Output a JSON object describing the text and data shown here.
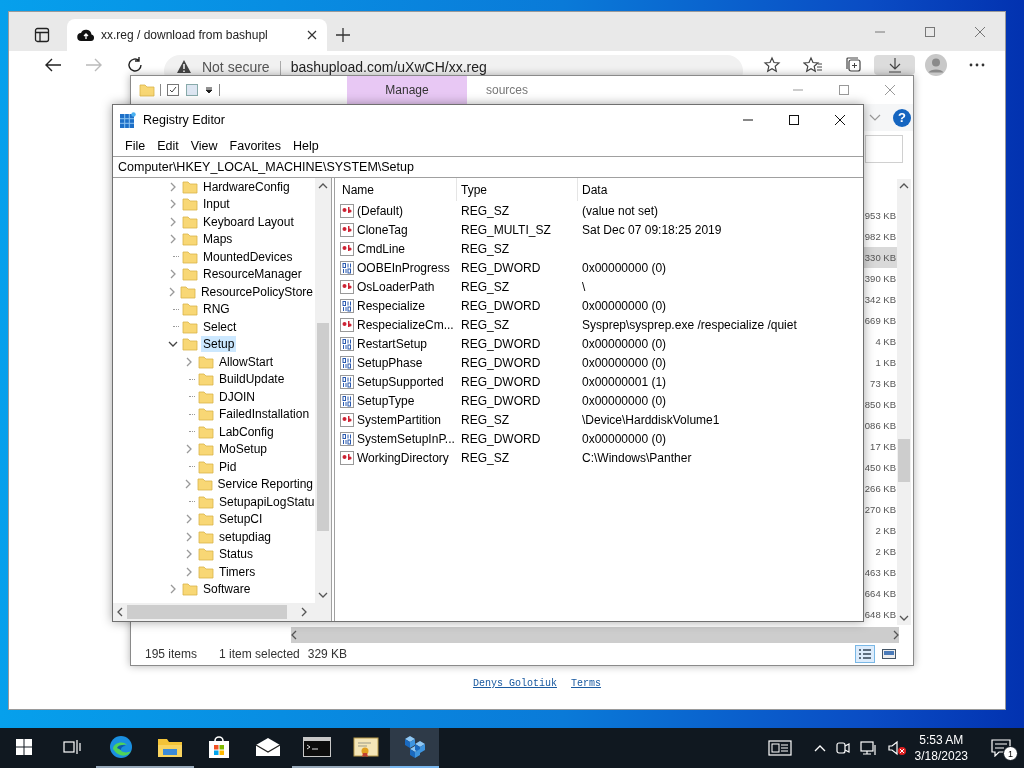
{
  "browser": {
    "tab": {
      "title": "xx.reg / download from bashupl"
    },
    "address": {
      "security": "Not secure",
      "url": "bashupload.com/uXwCH/xx.reg"
    },
    "toolbar": [
      {
        "kind": "favorite-add",
        "selected": false
      },
      {
        "kind": "favorites",
        "selected": false
      },
      {
        "kind": "collections",
        "selected": false
      },
      {
        "kind": "downloads",
        "selected": true
      },
      {
        "kind": "profile",
        "selected": false
      },
      {
        "kind": "more",
        "selected": false
      }
    ],
    "footer_links": [
      "Denys Golotiuk",
      "Terms"
    ]
  },
  "explorer": {
    "ribbon_tabs": [
      {
        "label": "Manage",
        "highlighted": true
      },
      {
        "label": "sources",
        "highlighted": false
      }
    ],
    "help_glyph": "?",
    "sizes": [
      {
        "text": "953 KB",
        "selected": false
      },
      {
        "text": "982 KB",
        "selected": false
      },
      {
        "text": "330 KB",
        "selected": true
      },
      {
        "text": "390 KB",
        "selected": false
      },
      {
        "text": "342 KB",
        "selected": false
      },
      {
        "text": "669 KB",
        "selected": false
      },
      {
        "text": "4 KB",
        "selected": false
      },
      {
        "text": "1 KB",
        "selected": false
      },
      {
        "text": "73 KB",
        "selected": false
      },
      {
        "text": "850 KB",
        "selected": false
      },
      {
        "text": "086 KB",
        "selected": false
      },
      {
        "text": "17 KB",
        "selected": false
      },
      {
        "text": "450 KB",
        "selected": false
      },
      {
        "text": "266 KB",
        "selected": false
      },
      {
        "text": "270 KB",
        "selected": false
      },
      {
        "text": "2 KB",
        "selected": false
      },
      {
        "text": "2 KB",
        "selected": false
      },
      {
        "text": "463 KB",
        "selected": false
      },
      {
        "text": "664 KB",
        "selected": false
      },
      {
        "text": "648 KB",
        "selected": false
      }
    ],
    "status": {
      "items": "195 items",
      "selection": "1 item selected",
      "size": "329 KB"
    },
    "view_buttons": [
      {
        "kind": "details",
        "selected": true
      },
      {
        "kind": "thumbnails",
        "selected": false
      }
    ]
  },
  "registry_editor": {
    "title": "Registry Editor",
    "menu": [
      "File",
      "Edit",
      "View",
      "Favorites",
      "Help"
    ],
    "address": "Computer\\HKEY_LOCAL_MACHINE\\SYSTEM\\Setup",
    "tree": [
      {
        "label": "HardwareConfig",
        "expandable": true,
        "expanded": false,
        "selected": false
      },
      {
        "label": "Input",
        "expandable": true,
        "expanded": false,
        "selected": false
      },
      {
        "label": "Keyboard Layout",
        "expandable": true,
        "expanded": false,
        "selected": false
      },
      {
        "label": "Maps",
        "expandable": true,
        "expanded": false,
        "selected": false
      },
      {
        "label": "MountedDevices",
        "expandable": false,
        "selected": false
      },
      {
        "label": "ResourceManager",
        "expandable": true,
        "expanded": false,
        "selected": false
      },
      {
        "label": "ResourcePolicyStore",
        "expandable": true,
        "expanded": false,
        "selected": false
      },
      {
        "label": "RNG",
        "expandable": false,
        "selected": false
      },
      {
        "label": "Select",
        "expandable": false,
        "selected": false
      },
      {
        "label": "Setup",
        "expandable": true,
        "expanded": true,
        "selected": true,
        "children": [
          {
            "label": "AllowStart",
            "expandable": true,
            "expanded": false,
            "selected": false
          },
          {
            "label": "BuildUpdate",
            "expandable": false,
            "selected": false
          },
          {
            "label": "DJOIN",
            "expandable": false,
            "selected": false
          },
          {
            "label": "FailedInstallation",
            "expandable": false,
            "selected": false
          },
          {
            "label": "LabConfig",
            "expandable": false,
            "selected": false
          },
          {
            "label": "MoSetup",
            "expandable": true,
            "expanded": false,
            "selected": false
          },
          {
            "label": "Pid",
            "expandable": false,
            "selected": false
          },
          {
            "label": "Service Reporting",
            "expandable": true,
            "expanded": false,
            "selected": false
          },
          {
            "label": "SetupapiLogStatu",
            "expandable": false,
            "selected": false
          },
          {
            "label": "SetupCI",
            "expandable": true,
            "expanded": false,
            "selected": false
          },
          {
            "label": "setupdiag",
            "expandable": true,
            "expanded": false,
            "selected": false
          },
          {
            "label": "Status",
            "expandable": true,
            "expanded": false,
            "selected": false
          },
          {
            "label": "Timers",
            "expandable": true,
            "expanded": false,
            "selected": false
          }
        ]
      },
      {
        "label": "Software",
        "expandable": true,
        "expanded": false,
        "selected": false
      }
    ],
    "columns": [
      "Name",
      "Type",
      "Data"
    ],
    "values": [
      {
        "kind": "string",
        "name": "(Default)",
        "type": "REG_SZ",
        "data": "(value not set)"
      },
      {
        "kind": "string",
        "name": "CloneTag",
        "type": "REG_MULTI_SZ",
        "data": "Sat Dec 07 09:18:25 2019"
      },
      {
        "kind": "string",
        "name": "CmdLine",
        "type": "REG_SZ"
      },
      {
        "kind": "binary",
        "name": "OOBEInProgress",
        "type": "REG_DWORD",
        "data": "0x00000000 (0)"
      },
      {
        "kind": "string",
        "name": "OsLoaderPath",
        "type": "REG_SZ",
        "data": "\\"
      },
      {
        "kind": "binary",
        "name": "Respecialize",
        "type": "REG_DWORD",
        "data": "0x00000000 (0)"
      },
      {
        "kind": "string",
        "name": "RespecializeCm...",
        "type": "REG_SZ",
        "data": "Sysprep\\sysprep.exe /respecialize /quiet"
      },
      {
        "kind": "binary",
        "name": "RestartSetup",
        "type": "REG_DWORD",
        "data": "0x00000000 (0)"
      },
      {
        "kind": "binary",
        "name": "SetupPhase",
        "type": "REG_DWORD",
        "data": "0x00000000 (0)"
      },
      {
        "kind": "binary",
        "name": "SetupSupported",
        "type": "REG_DWORD",
        "data": "0x00000001 (1)"
      },
      {
        "kind": "binary",
        "name": "SetupType",
        "type": "REG_DWORD",
        "data": "0x00000000 (0)"
      },
      {
        "kind": "string",
        "name": "SystemPartition",
        "type": "REG_SZ",
        "data": "\\Device\\HarddiskVolume1"
      },
      {
        "kind": "binary",
        "name": "SystemSetupInP...",
        "type": "REG_DWORD",
        "data": "0x00000000 (0)"
      },
      {
        "kind": "string",
        "name": "WorkingDirectory",
        "type": "REG_SZ",
        "data": "C:\\Windows\\Panther"
      }
    ]
  },
  "taskbar": {
    "apps": [
      {
        "kind": "browser",
        "running": true,
        "active": false
      },
      {
        "kind": "folder",
        "running": true,
        "active": false
      },
      {
        "kind": "store",
        "running": false,
        "active": false
      },
      {
        "kind": "mail",
        "running": false,
        "active": false
      },
      {
        "kind": "terminal",
        "running": true,
        "active": false
      },
      {
        "kind": "certificate",
        "running": true,
        "active": false
      },
      {
        "kind": "registry",
        "running": true,
        "active": true
      }
    ],
    "clock": {
      "time": "5:53 AM",
      "date": "3/18/2023"
    },
    "notifications": "1"
  }
}
